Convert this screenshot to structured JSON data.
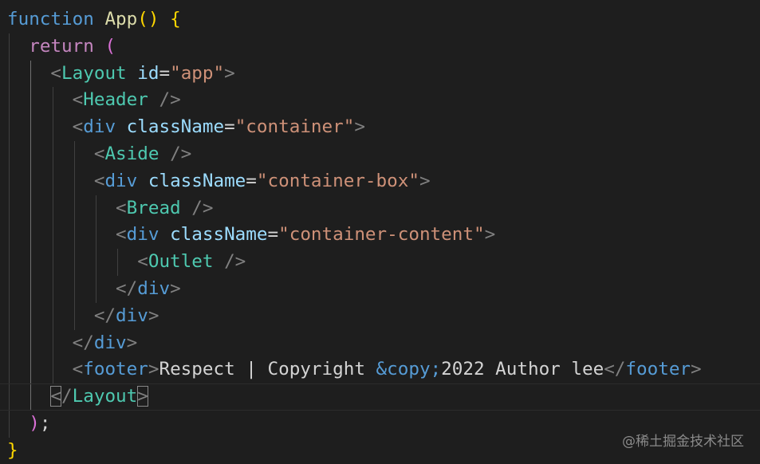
{
  "editor": {
    "background": "#1e1e1e",
    "lines": [
      [
        [
          "kw-fn",
          "function"
        ],
        [
          "plain",
          " "
        ],
        [
          "fn",
          "App"
        ],
        [
          "br",
          "()"
        ],
        [
          "plain",
          " "
        ],
        [
          "br",
          "{"
        ]
      ],
      [
        [
          "plain",
          "  "
        ],
        [
          "kw-ctl",
          "return"
        ],
        [
          "plain",
          " "
        ],
        [
          "br2",
          "("
        ]
      ],
      [
        [
          "plain",
          "    "
        ],
        [
          "pun",
          "<"
        ],
        [
          "tag",
          "Layout"
        ],
        [
          "plain",
          " "
        ],
        [
          "attr",
          "id"
        ],
        [
          "plain",
          "="
        ],
        [
          "str",
          "\"app\""
        ],
        [
          "pun",
          ">"
        ]
      ],
      [
        [
          "plain",
          "      "
        ],
        [
          "pun",
          "<"
        ],
        [
          "tag",
          "Header"
        ],
        [
          "plain",
          " "
        ],
        [
          "pun",
          "/>"
        ]
      ],
      [
        [
          "plain",
          "      "
        ],
        [
          "pun",
          "<"
        ],
        [
          "html",
          "div"
        ],
        [
          "plain",
          " "
        ],
        [
          "attr",
          "className"
        ],
        [
          "plain",
          "="
        ],
        [
          "str",
          "\"container\""
        ],
        [
          "pun",
          ">"
        ]
      ],
      [
        [
          "plain",
          "        "
        ],
        [
          "pun",
          "<"
        ],
        [
          "tag",
          "Aside"
        ],
        [
          "plain",
          " "
        ],
        [
          "pun",
          "/>"
        ]
      ],
      [
        [
          "plain",
          "        "
        ],
        [
          "pun",
          "<"
        ],
        [
          "html",
          "div"
        ],
        [
          "plain",
          " "
        ],
        [
          "attr",
          "className"
        ],
        [
          "plain",
          "="
        ],
        [
          "str",
          "\"container-box\""
        ],
        [
          "pun",
          ">"
        ]
      ],
      [
        [
          "plain",
          "          "
        ],
        [
          "pun",
          "<"
        ],
        [
          "tag",
          "Bread"
        ],
        [
          "plain",
          " "
        ],
        [
          "pun",
          "/>"
        ]
      ],
      [
        [
          "plain",
          "          "
        ],
        [
          "pun",
          "<"
        ],
        [
          "html",
          "div"
        ],
        [
          "plain",
          " "
        ],
        [
          "attr",
          "className"
        ],
        [
          "plain",
          "="
        ],
        [
          "str",
          "\"container-content\""
        ],
        [
          "pun",
          ">"
        ]
      ],
      [
        [
          "plain",
          "            "
        ],
        [
          "pun",
          "<"
        ],
        [
          "tag",
          "Outlet"
        ],
        [
          "plain",
          " "
        ],
        [
          "pun",
          "/>"
        ]
      ],
      [
        [
          "plain",
          "          "
        ],
        [
          "pun",
          "</"
        ],
        [
          "html",
          "div"
        ],
        [
          "pun",
          ">"
        ]
      ],
      [
        [
          "plain",
          "        "
        ],
        [
          "pun",
          "</"
        ],
        [
          "html",
          "div"
        ],
        [
          "pun",
          ">"
        ]
      ],
      [
        [
          "plain",
          "      "
        ],
        [
          "pun",
          "</"
        ],
        [
          "html",
          "div"
        ],
        [
          "pun",
          ">"
        ]
      ],
      [
        [
          "plain",
          "      "
        ],
        [
          "pun",
          "<"
        ],
        [
          "html",
          "footer"
        ],
        [
          "pun",
          ">"
        ],
        [
          "plain",
          "Respect | Copyright "
        ],
        [
          "ent",
          "&copy;"
        ],
        [
          "plain",
          "2022 Author lee"
        ],
        [
          "pun",
          "</"
        ],
        [
          "html",
          "footer"
        ],
        [
          "pun",
          ">"
        ]
      ],
      [
        [
          "plain",
          "    "
        ],
        [
          "pun-match",
          "<"
        ],
        [
          "pun",
          "/"
        ],
        [
          "tag",
          "Layout"
        ],
        [
          "pun-match",
          ">"
        ]
      ],
      [
        [
          "plain",
          "  "
        ],
        [
          "br2",
          ")"
        ],
        [
          "plain",
          ";"
        ]
      ],
      [
        [
          "br",
          "}"
        ]
      ]
    ],
    "current_line": 14
  },
  "watermark": "@稀土掘金技术社区"
}
